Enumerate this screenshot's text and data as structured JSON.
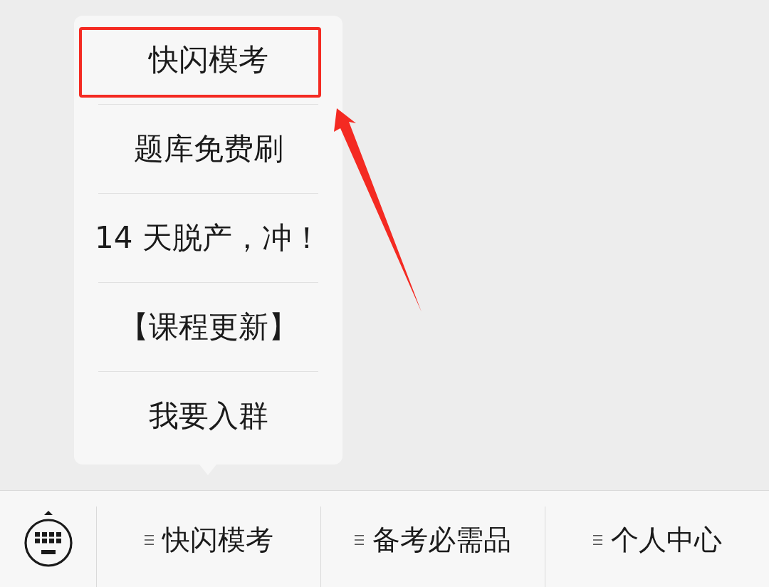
{
  "menu_popup": {
    "items": [
      {
        "label": "快闪模考",
        "highlighted": true
      },
      {
        "label": "题库免费刷",
        "highlighted": false
      },
      {
        "label": "14 天脱产，冲！",
        "highlighted": false
      },
      {
        "label": "【课程更新】",
        "highlighted": false
      },
      {
        "label": "我要入群",
        "highlighted": false
      }
    ]
  },
  "bottom_bar": {
    "items": [
      {
        "label": "快闪模考"
      },
      {
        "label": "备考必需品"
      },
      {
        "label": "个人中心"
      }
    ]
  }
}
